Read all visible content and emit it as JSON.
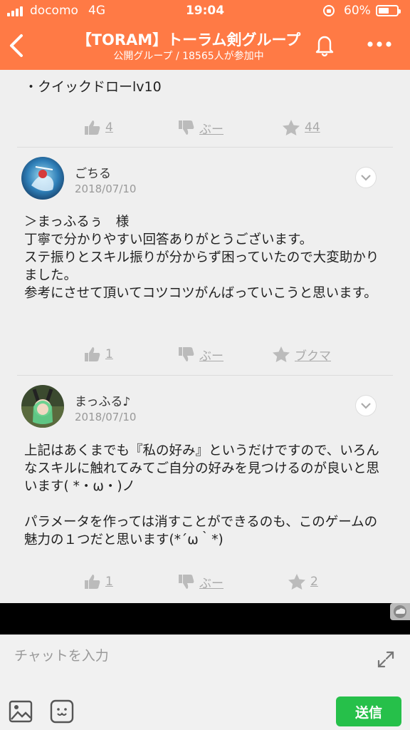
{
  "status_bar": {
    "carrier": "docomo",
    "network": "4G",
    "time": "19:04",
    "battery_percent": "60%",
    "battery_level": 0.6
  },
  "header": {
    "title": "【TORAM】トーラム剣グループ",
    "subtitle": "公開グループ / 18565人が参加中",
    "icons": [
      "back-icon",
      "bell-icon",
      "more-icon"
    ]
  },
  "feed": {
    "cut_post": {
      "text_line": "・クイックドローlv10",
      "likes": "4",
      "boo": "ぶー",
      "stars": "44"
    },
    "posts": [
      {
        "author": "ごちる",
        "date": "2018/07/10",
        "text": "＞まっふるぅ　様\n丁寧で分かりやすい回答ありがとうございます。\nステ振りとスキル振りが分からず困っていたので大変助かりました。\n参考にさせて頂いてコツコツがんばっていこうと思います。",
        "likes": "1",
        "boo": "ぶー",
        "bookmark": "ブクマ"
      },
      {
        "author": "まっふる♪",
        "date": "2018/07/10",
        "text": "上記はあくまでも『私の好み』というだけですので、いろんなスキルに触れてみてご自分の好みを見つけるのが良いと思います( *・ω・)ノ\n\nパラメータを作っては消すことができるのも、このゲームの魅力の１つだと思います(*´ω｀*)",
        "likes": "1",
        "boo": "ぶー",
        "stars": "2"
      }
    ]
  },
  "composer": {
    "placeholder": "チャットを入力",
    "send_label": "送信"
  },
  "colors": {
    "header_bg": "#ff7a45",
    "send_bg": "#26c04a"
  }
}
